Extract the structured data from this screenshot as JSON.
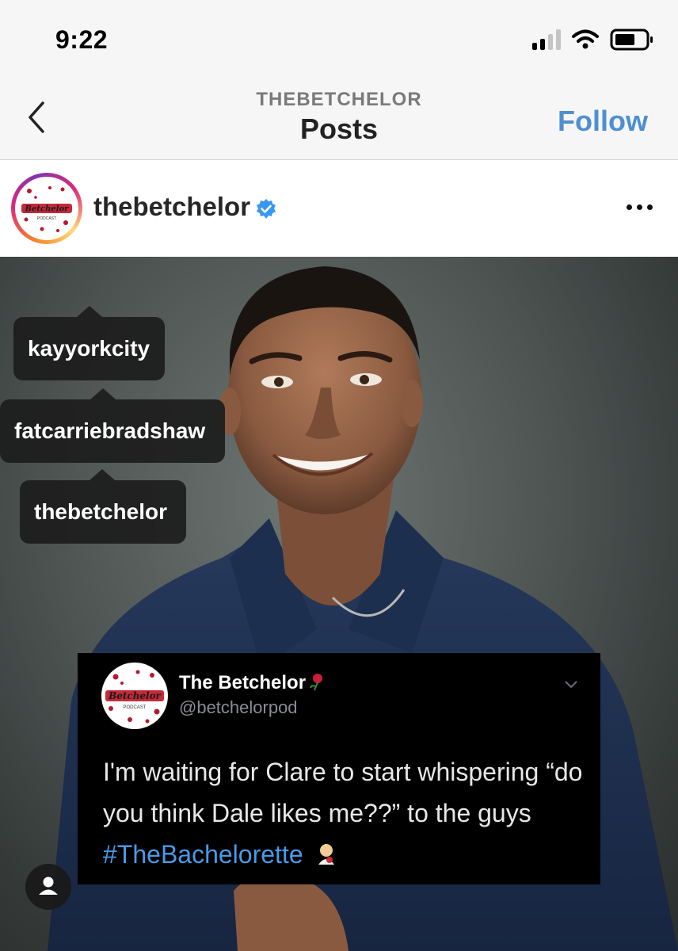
{
  "status": {
    "time": "9:22"
  },
  "nav": {
    "subtitle": "THEBETCHELOR",
    "title": "Posts",
    "follow_label": "Follow"
  },
  "post": {
    "username": "thebetchelor"
  },
  "tags": [
    {
      "label": "kayyorkcity"
    },
    {
      "label": "fatcarriebradshaw"
    },
    {
      "label": "thebetchelor"
    }
  ],
  "tweet": {
    "name": "The Betchelor",
    "handle": "@betchelorpod",
    "text_before": "I'm waiting for Clare to start whispering “do you think Dale likes me??” to the guys ",
    "hashtag": "#TheBachelorette"
  },
  "logo": {
    "line1": "Betchelor",
    "line2": "PODCAST"
  },
  "colors": {
    "accent": "#4f8fd0",
    "hashtag": "#4a9ae8",
    "verified": "#3897f0"
  },
  "icons": [
    "back-chevron-icon",
    "signal-icon",
    "wifi-icon",
    "battery-icon",
    "verified-badge-icon",
    "more-options-icon",
    "user-tag-icon",
    "rose-icon"
  ]
}
